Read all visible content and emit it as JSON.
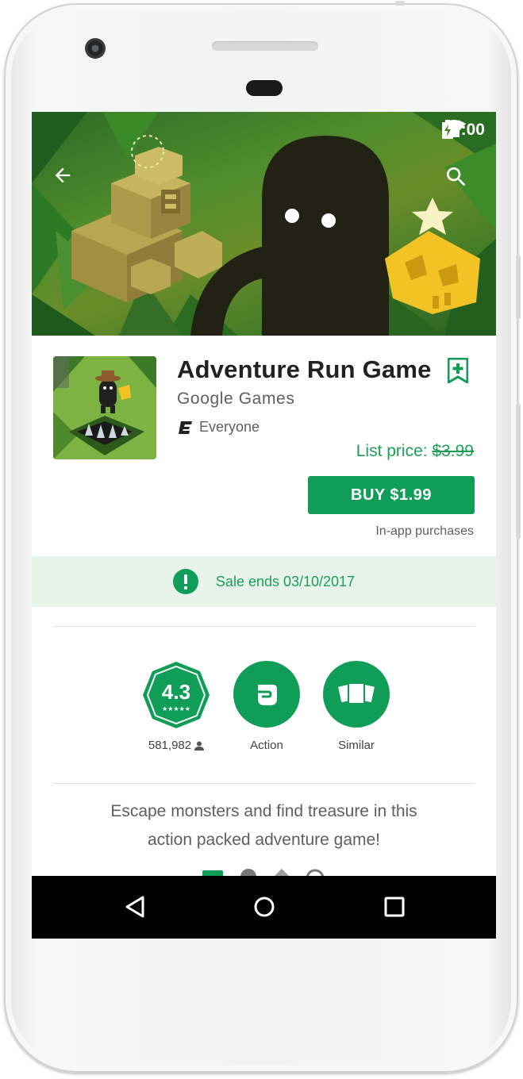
{
  "status_bar": {
    "time": "07:00",
    "icons": [
      "wifi-icon",
      "signal-icon",
      "battery-icon"
    ]
  },
  "top_actions": {
    "back_icon": "arrow-left-icon",
    "search_icon": "search-icon"
  },
  "app": {
    "title": "Adventure Run Game",
    "developer": "Google Games",
    "content_rating": "Everyone",
    "content_rating_icon": "esrb-e-icon",
    "wishlist_icon": "bookmark-plus-icon",
    "list_price_label": "List price:",
    "list_price_value": "$3.99",
    "buy_label": "BUY $1.99",
    "in_app_note": "In-app purchases"
  },
  "sale": {
    "icon": "exclamation-circle-icon",
    "text": "Sale ends 03/10/2017"
  },
  "stats": {
    "rating_value": "4.3",
    "rating_count": "581,982",
    "rating_count_icon": "person-icon",
    "category_label": "Action",
    "category_icon": "fist-icon",
    "similar_label": "Similar",
    "similar_icon": "cards-icon"
  },
  "description": {
    "line1": "Escape monsters and find treasure in this",
    "line2": "action packed adventure game!"
  },
  "nav_bar": {
    "back": "triangle-back-icon",
    "home": "circle-home-icon",
    "recents": "square-recents-icon"
  },
  "colors": {
    "accent": "#0f9d58",
    "accent_text": "#1b9f57",
    "sale_bg": "#e8f3ec",
    "nav_bg": "#000000"
  }
}
